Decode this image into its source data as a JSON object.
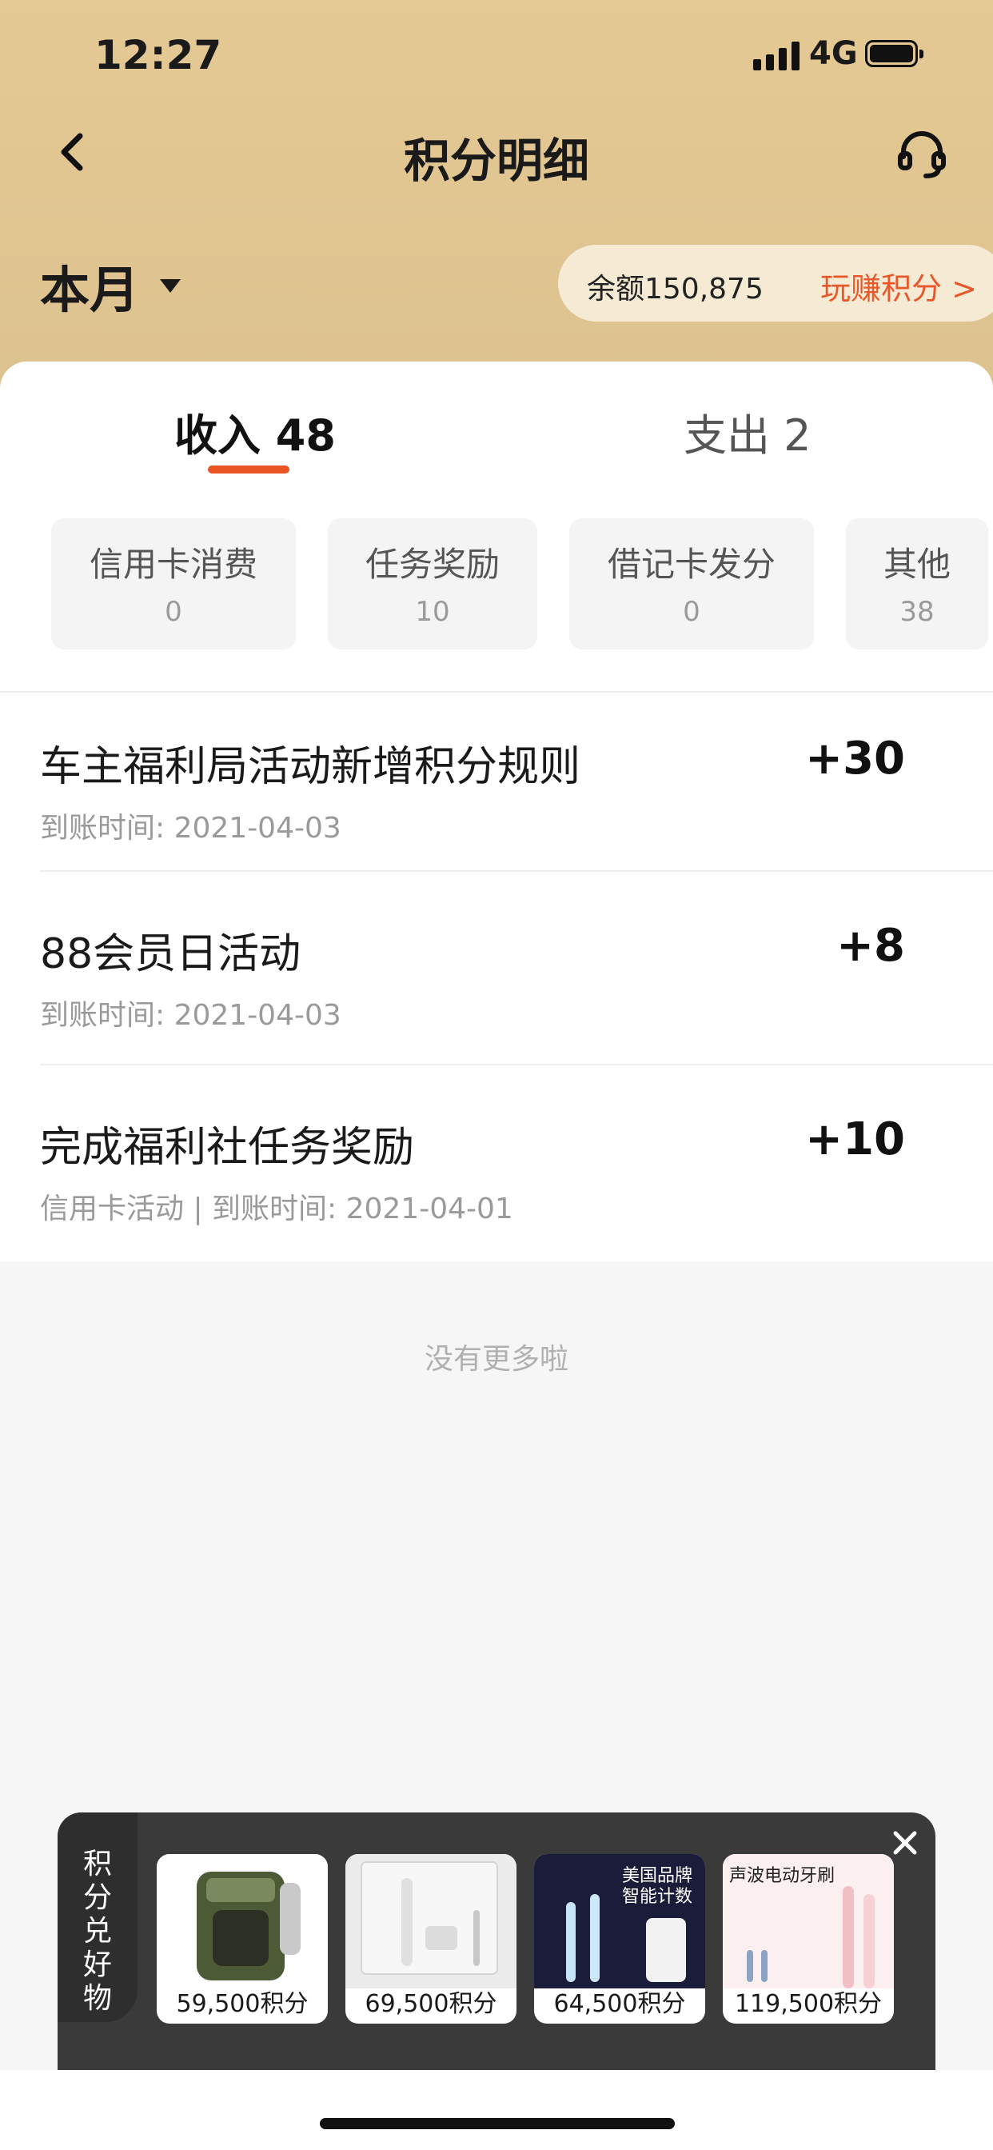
{
  "status_bar": {
    "time": "12:27",
    "network": "4G"
  },
  "nav": {
    "title": "积分明细",
    "back_icon": "chevron-left-icon",
    "service_icon": "headset-icon"
  },
  "filter": {
    "period": "本月"
  },
  "balance": {
    "text": "余额150,875",
    "earn_label": "玩赚积分",
    "earn_arrow": ">"
  },
  "tabs": [
    {
      "label": "收入 48",
      "active": true
    },
    {
      "label": "支出 2",
      "active": false
    }
  ],
  "categories": [
    {
      "label": "信用卡消费",
      "count": "0"
    },
    {
      "label": "任务奖励",
      "count": "10"
    },
    {
      "label": "借记卡发分",
      "count": "0"
    },
    {
      "label": "其他",
      "count": "38"
    }
  ],
  "records": [
    {
      "title": "车主福利局活动新增积分规则",
      "meta": "到账时间: 2021-04-03",
      "points": "+30"
    },
    {
      "title": "88会员日活动",
      "meta": "到账时间: 2021-04-03",
      "points": "+8"
    },
    {
      "title": "完成福利社任务奖励",
      "meta": "信用卡活动 | 到账时间: 2021-04-01",
      "points": "+10"
    }
  ],
  "footer_text": "没有更多啦",
  "promo": {
    "label": "积分兑好物",
    "products": [
      {
        "price": "59,500积分"
      },
      {
        "price": "69,500积分"
      },
      {
        "price": "64,500积分",
        "tagline": "美国品牌 智能计数"
      },
      {
        "price": "119,500积分",
        "tagline": "声波电动牙刷"
      }
    ]
  },
  "colors": {
    "header": "#e5c994",
    "accent": "#ea5524",
    "earn": "#e8582a"
  }
}
